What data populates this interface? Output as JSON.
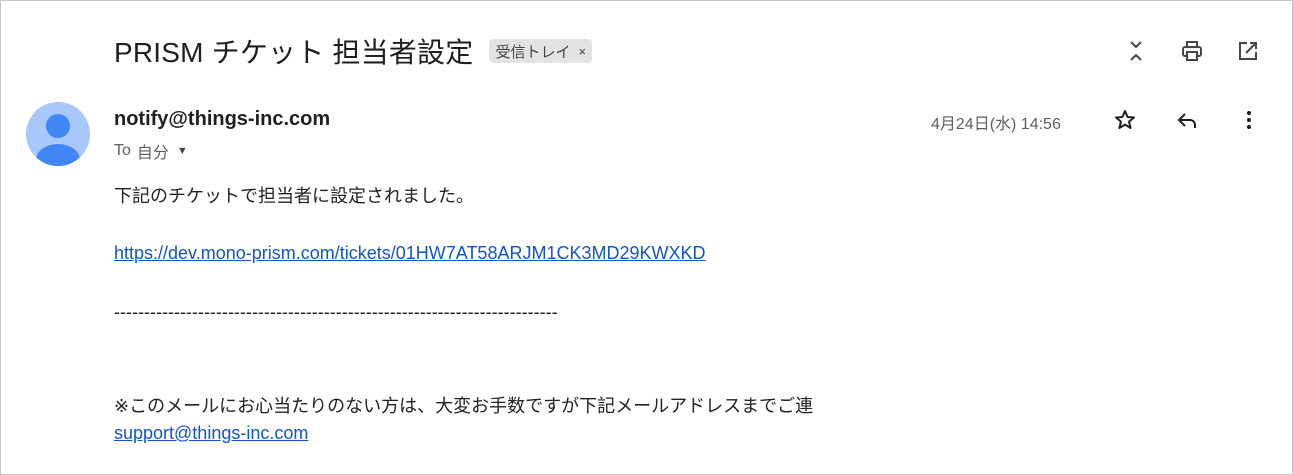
{
  "email": {
    "subject": "PRISM チケット 担当者設定",
    "label": "受信トレイ",
    "label_remove": "×",
    "sender": "notify@things-inc.com",
    "to_prefix": "To",
    "to_name": "自分",
    "date": "4月24日(水) 14:56",
    "body": {
      "line1": "下記のチケットで担当者に設定されました。",
      "link": "https://dev.mono-prism.com/tickets/01HW7AT58ARJM1CK3MD29KWXKD",
      "divider": "--------------------------------------------------------------------------",
      "note": "※このメールにお心当たりのない方は、大変お手数ですが下記メールアドレスまでご連",
      "support": "support@things-inc.com"
    }
  },
  "icons": {
    "top": [
      "collapse-icon",
      "print-icon",
      "open-in-new-window-icon"
    ],
    "message": [
      "star-icon",
      "reply-icon",
      "more-vert-icon"
    ]
  }
}
